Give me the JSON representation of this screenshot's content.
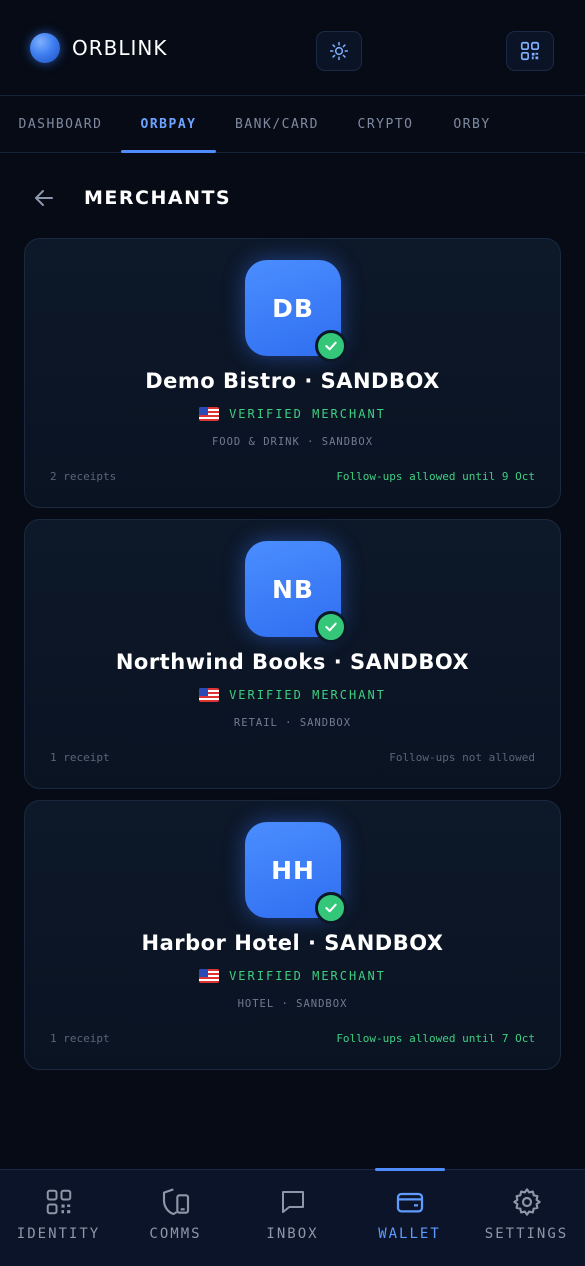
{
  "app": {
    "name": "ORBLINK"
  },
  "header": {
    "theme_icon": "sun-icon",
    "qr_icon": "qr-code-icon"
  },
  "tabs": [
    {
      "label": "DASHBOARD",
      "active": false
    },
    {
      "label": "ORBPAY",
      "active": true
    },
    {
      "label": "BANK/CARD",
      "active": false
    },
    {
      "label": "CRYPTO",
      "active": false
    },
    {
      "label": "ORBY",
      "active": false
    }
  ],
  "page": {
    "title": "MERCHANTS",
    "back_icon": "arrow-left-icon"
  },
  "merchants": [
    {
      "initials": "DB",
      "name": "Demo Bistro · SANDBOX",
      "verified_label": "VERIFIED MERCHANT",
      "flag": "us-flag-icon",
      "category": "FOOD & DRINK · SANDBOX",
      "receipts": "2 receipts",
      "followups": "Follow-ups allowed until 9 Oct",
      "followups_allowed": true
    },
    {
      "initials": "NB",
      "name": "Northwind Books · SANDBOX",
      "verified_label": "VERIFIED MERCHANT",
      "flag": "us-flag-icon",
      "category": "RETAIL · SANDBOX",
      "receipts": "1 receipt",
      "followups": "Follow-ups not allowed",
      "followups_allowed": false
    },
    {
      "initials": "HH",
      "name": "Harbor Hotel · SANDBOX",
      "verified_label": "VERIFIED MERCHANT",
      "flag": "us-flag-icon",
      "category": "HOTEL · SANDBOX",
      "receipts": "1 receipt",
      "followups": "Follow-ups allowed until 7 Oct",
      "followups_allowed": true
    }
  ],
  "bottom_nav": [
    {
      "label": "IDENTITY",
      "icon": "qr-code-icon",
      "active": false
    },
    {
      "label": "COMMS",
      "icon": "shield-phone-icon",
      "active": false
    },
    {
      "label": "INBOX",
      "icon": "chat-bubble-icon",
      "active": false
    },
    {
      "label": "WALLET",
      "icon": "wallet-icon",
      "active": true
    },
    {
      "label": "SETTINGS",
      "icon": "gear-icon",
      "active": false
    }
  ],
  "colors": {
    "background": "#060b16",
    "accent": "#4f8cff",
    "verified": "#3fcf82",
    "card": "#0d1829"
  }
}
